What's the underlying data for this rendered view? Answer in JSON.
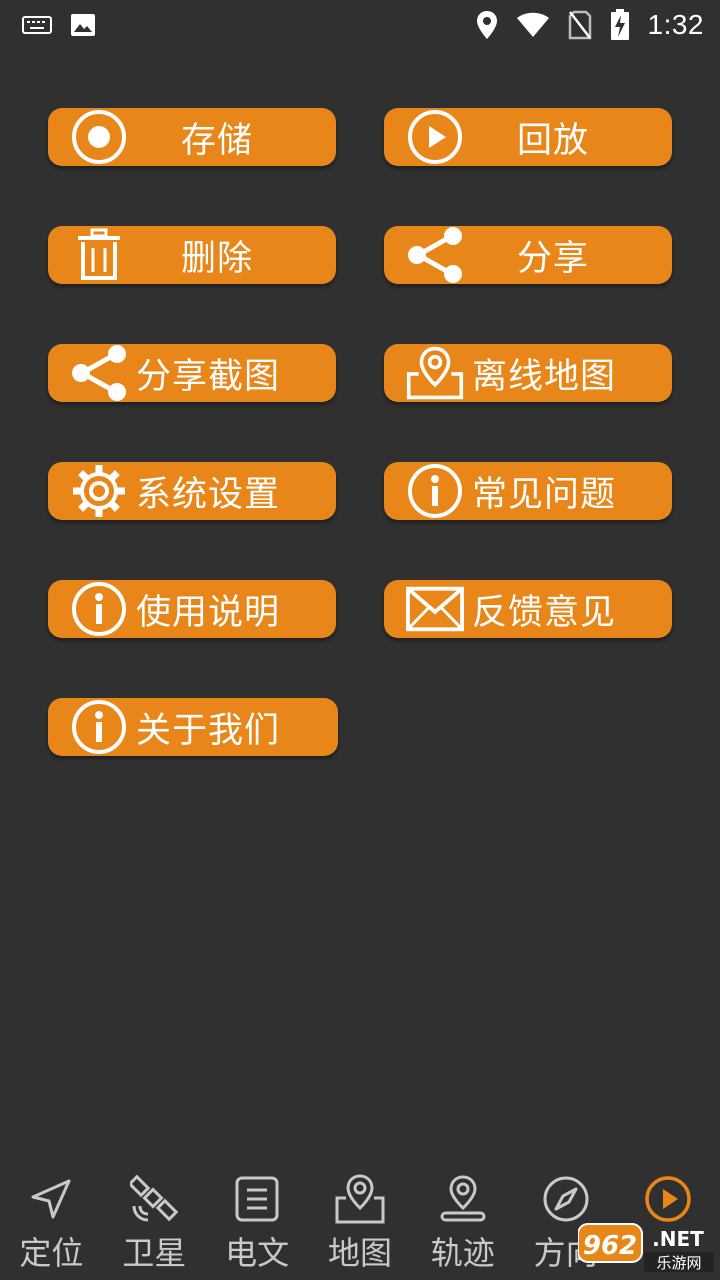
{
  "status_bar": {
    "time": "1:32",
    "left_icons": [
      "keyboard-icon",
      "image-icon"
    ],
    "right_icons": [
      "location-icon",
      "wifi-icon",
      "no-sim-icon",
      "battery-charging-icon"
    ]
  },
  "menu": {
    "items": [
      {
        "label": "存储",
        "icon": "record-icon"
      },
      {
        "label": "回放",
        "icon": "play-circle-icon"
      },
      {
        "label": "删除",
        "icon": "trash-icon"
      },
      {
        "label": "分享",
        "icon": "share-icon"
      },
      {
        "label": "分享截图",
        "icon": "share-icon"
      },
      {
        "label": "离线地图",
        "icon": "map-pin-icon"
      },
      {
        "label": "系统设置",
        "icon": "gear-icon"
      },
      {
        "label": "常见问题",
        "icon": "info-icon"
      },
      {
        "label": "使用说明",
        "icon": "info-icon"
      },
      {
        "label": "反馈意见",
        "icon": "mail-icon"
      },
      {
        "label": "关于我们",
        "icon": "info-icon"
      }
    ],
    "button_color": "#e8861a"
  },
  "bottom_nav": {
    "items": [
      {
        "label": "定位",
        "icon": "navigation-arrow-icon"
      },
      {
        "label": "卫星",
        "icon": "satellite-icon"
      },
      {
        "label": "电文",
        "icon": "document-icon"
      },
      {
        "label": "地图",
        "icon": "map-icon"
      },
      {
        "label": "轨迹",
        "icon": "track-pin-icon"
      },
      {
        "label": "方向",
        "icon": "compass-icon"
      },
      {
        "label": "",
        "icon": "play-circle-icon",
        "active": true
      }
    ],
    "active_color": "#e8861a",
    "inactive_color": "#c9c9c9"
  },
  "watermark": {
    "text_top": "962",
    "text_net": ".NET",
    "text_bottom": "乐游网"
  }
}
